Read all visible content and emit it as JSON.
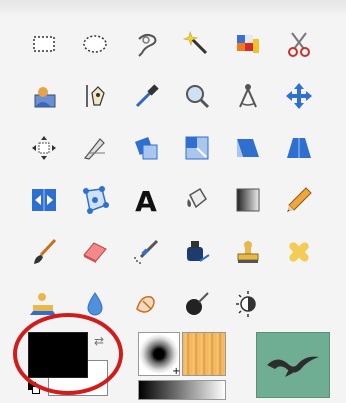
{
  "tools": [
    {
      "name": "rect-select-icon",
      "icon": "rect-select"
    },
    {
      "name": "ellipse-select-icon",
      "icon": "ellipse-select"
    },
    {
      "name": "free-select-icon",
      "icon": "lasso"
    },
    {
      "name": "fuzzy-select-icon",
      "icon": "magic-wand"
    },
    {
      "name": "select-by-color-icon",
      "icon": "color-select"
    },
    {
      "name": "scissors-select-icon",
      "icon": "scissors"
    },
    {
      "name": "foreground-select-icon",
      "icon": "foreground-select"
    },
    {
      "name": "paths-icon",
      "icon": "paths"
    },
    {
      "name": "color-picker-icon",
      "icon": "eyedropper"
    },
    {
      "name": "zoom-icon",
      "icon": "magnifier"
    },
    {
      "name": "measure-icon",
      "icon": "compass"
    },
    {
      "name": "move-icon",
      "icon": "move-arrows"
    },
    {
      "name": "align-icon",
      "icon": "align"
    },
    {
      "name": "crop-icon",
      "icon": "knife"
    },
    {
      "name": "rotate-icon",
      "icon": "rotate"
    },
    {
      "name": "scale-icon",
      "icon": "scale"
    },
    {
      "name": "shear-icon",
      "icon": "shear"
    },
    {
      "name": "perspective-icon",
      "icon": "perspective"
    },
    {
      "name": "flip-icon",
      "icon": "flip"
    },
    {
      "name": "cage-transform-icon",
      "icon": "cage"
    },
    {
      "name": "text-icon",
      "icon": "text-A"
    },
    {
      "name": "bucket-fill-icon",
      "icon": "bucket"
    },
    {
      "name": "blend-icon",
      "icon": "gradient-square"
    },
    {
      "name": "pencil-icon",
      "icon": "pencil"
    },
    {
      "name": "paintbrush-icon",
      "icon": "paintbrush"
    },
    {
      "name": "eraser-icon",
      "icon": "eraser"
    },
    {
      "name": "airbrush-icon",
      "icon": "airbrush"
    },
    {
      "name": "ink-icon",
      "icon": "ink"
    },
    {
      "name": "clone-icon",
      "icon": "stamp"
    },
    {
      "name": "heal-icon",
      "icon": "bandage"
    },
    {
      "name": "perspective-clone-icon",
      "icon": "perspective-stamp"
    },
    {
      "name": "blur-sharpen-icon",
      "icon": "water-drop"
    },
    {
      "name": "smudge-icon",
      "icon": "smudge"
    },
    {
      "name": "dodge-burn-icon",
      "icon": "dodge-burn"
    },
    {
      "name": "desaturate-icon",
      "icon": "desaturate"
    }
  ],
  "colors": {
    "foreground": "#000000",
    "background": "#ffffff",
    "highlight_ring": "#d11c1c",
    "image_thumbnail": "#6fae93"
  },
  "brush": {
    "icon": "brush-preview"
  },
  "pattern": {
    "icon": "wood-pattern"
  },
  "gradient": {
    "icon": "black-to-white-gradient"
  },
  "active_image": {
    "icon": "bird-image-thumbnail"
  }
}
